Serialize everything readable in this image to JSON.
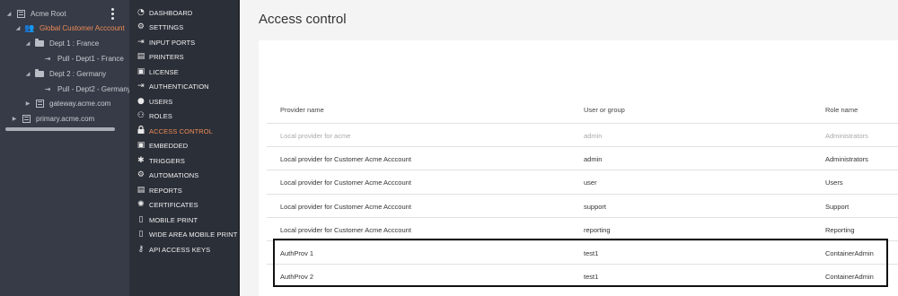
{
  "tree": {
    "items": [
      {
        "label": "Acme Root",
        "icon": "server-icon",
        "caret": "◢"
      },
      {
        "label": "Global Customer Acccount",
        "icon": "users-icon",
        "caret": "◢"
      },
      {
        "label": "Dept 1 : France",
        "icon": "folder-icon",
        "caret": "◢"
      },
      {
        "label": "Pull - Dept1 - France",
        "icon": "printer-queue-icon"
      },
      {
        "label": "Dept 2 : Germany",
        "icon": "folder-icon",
        "caret": "◢"
      },
      {
        "label": "Pull - Dept2 - Germany",
        "icon": "printer-queue-icon"
      },
      {
        "label": "gateway.acme.com",
        "icon": "server-icon",
        "caret": "▶"
      },
      {
        "label": "primary.acme.com",
        "icon": "server-icon",
        "caret": "▶"
      }
    ],
    "selected_color": "#ef8a55"
  },
  "nav": {
    "items": [
      {
        "label": "DASHBOARD",
        "icon": "dashboard-icon",
        "glyph": "◔"
      },
      {
        "label": "SETTINGS",
        "icon": "gear-icon",
        "glyph": "⚙"
      },
      {
        "label": "INPUT PORTS",
        "icon": "sign-in-icon",
        "glyph": "⇥"
      },
      {
        "label": "PRINTERS",
        "icon": "printer-icon",
        "glyph": "▤"
      },
      {
        "label": "LICENSE",
        "icon": "id-card-icon",
        "glyph": "▣"
      },
      {
        "label": "AUTHENTICATION",
        "icon": "sign-in-icon",
        "glyph": "⇥"
      },
      {
        "label": "USERS",
        "icon": "user-icon",
        "glyph": "●"
      },
      {
        "label": "ROLES",
        "icon": "users-icon",
        "glyph": "⚇"
      },
      {
        "label": "ACCESS CONTROL",
        "icon": "lock-icon",
        "glyph": "🔒",
        "active": true
      },
      {
        "label": "EMBEDDED",
        "icon": "embedded-icon",
        "glyph": "▣"
      },
      {
        "label": "TRIGGERS",
        "icon": "cog-icon",
        "glyph": "✱"
      },
      {
        "label": "AUTOMATIONS",
        "icon": "robot-icon",
        "glyph": "⚙"
      },
      {
        "label": "REPORTS",
        "icon": "report-icon",
        "glyph": "▤"
      },
      {
        "label": "CERTIFICATES",
        "icon": "certificate-icon",
        "glyph": "✺"
      },
      {
        "label": "MOBILE PRINT",
        "icon": "mobile-icon",
        "glyph": "▯"
      },
      {
        "label": "WIDE AREA MOBILE PRINT",
        "icon": "mobile-icon",
        "glyph": "▯"
      },
      {
        "label": "API ACCESS KEYS",
        "icon": "key-icon",
        "glyph": "⚷"
      }
    ],
    "active_color": "#ef8a55"
  },
  "main": {
    "title": "Access control",
    "columns": {
      "provider": "Provider name",
      "user": "User or group",
      "role": "Role name"
    },
    "rows": [
      {
        "provider": "Local provider for acme",
        "user": "admin",
        "role": "Administrators",
        "muted": true
      },
      {
        "provider": "Local provider for Customer Acme Acccount",
        "user": "admin",
        "role": "Administrators"
      },
      {
        "provider": "Local provider for Customer Acme Acccount",
        "user": "user",
        "role": "Users"
      },
      {
        "provider": "Local provider for Customer Acme Acccount",
        "user": "support",
        "role": "Support"
      },
      {
        "provider": "Local provider for Customer Acme Acccount",
        "user": "reporting",
        "role": "Reporting"
      },
      {
        "provider": "AuthProv 1",
        "user": "test1",
        "role": "ContainerAdmin"
      },
      {
        "provider": "AuthProv 2",
        "user": "test1",
        "role": "ContainerAdmin"
      }
    ]
  }
}
